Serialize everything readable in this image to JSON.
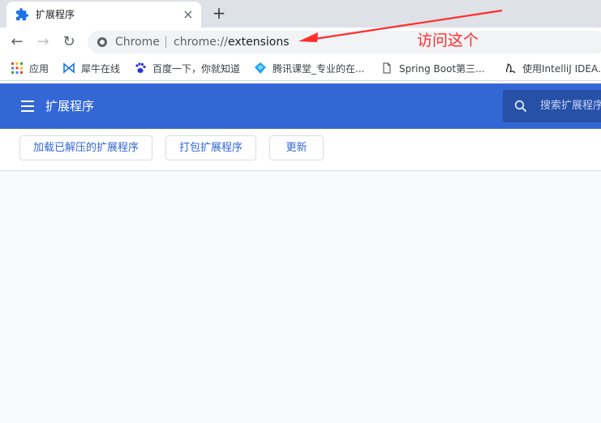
{
  "tab": {
    "title": "扩展程序",
    "close_label": "×",
    "new_tab_label": "+"
  },
  "toolbar": {
    "back_label": "←",
    "forward_label": "→",
    "reload_label": "↻",
    "omnibox_chip": "Chrome",
    "url_scheme": "chrome://",
    "url_path": "extensions"
  },
  "bookmarks": [
    {
      "label": "应用",
      "icon": "apps-grid-icon"
    },
    {
      "label": "犀牛在线",
      "icon": "bowtie-logo-icon"
    },
    {
      "label": "百度一下，你就知道",
      "icon": "paw-icon"
    },
    {
      "label": "腾讯课堂_专业的在...",
      "icon": "diamond-icon"
    },
    {
      "label": "Spring Boot第三...",
      "icon": "page-icon"
    },
    {
      "label": "使用IntelliJ IDEA...",
      "icon": "script-icon"
    }
  ],
  "header": {
    "title": "扩展程序",
    "search_placeholder": "搜索扩展程序"
  },
  "actions": {
    "load_unpacked": "加载已解压的扩展程序",
    "pack": "打包扩展程序",
    "update": "更新"
  },
  "annotation": {
    "text": "访问这个",
    "color": "#ff2d2d"
  },
  "colors": {
    "accent": "#3367d6",
    "tabstrip": "#dee1e6",
    "page_bg": "#f8f9fa"
  }
}
